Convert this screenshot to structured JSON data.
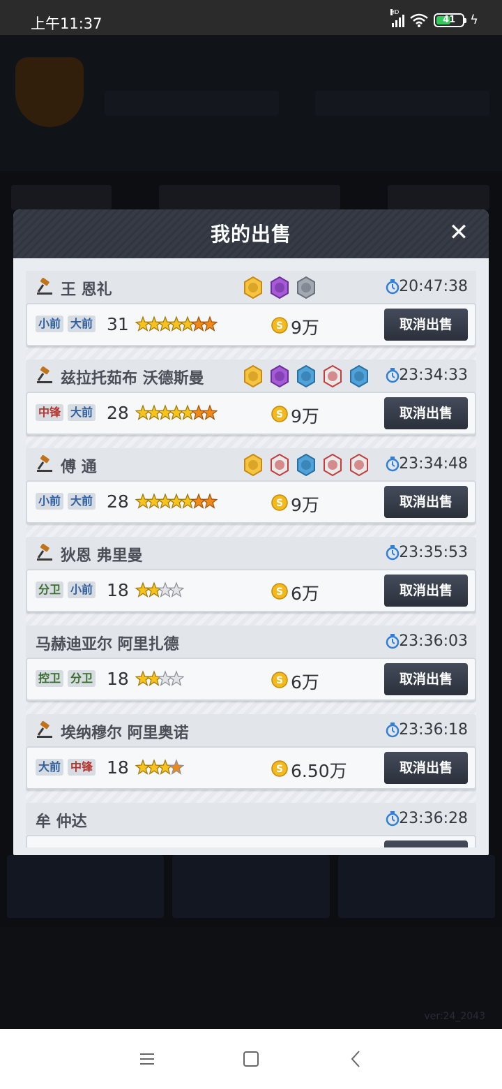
{
  "status_bar": {
    "time": "上午11:37",
    "battery": "41",
    "network": "HD"
  },
  "modal": {
    "title": "我的出售",
    "close": "✕"
  },
  "version": "ver:24_2043",
  "cancel_label": "取消出售",
  "colors": {
    "star_gold": "#f6c21c",
    "star_orange": "#ef8a18",
    "button": "#343a47"
  },
  "items": [
    {
      "name": "王 恩礼",
      "auction": true,
      "skills": [
        "gold",
        "purple",
        "gray"
      ],
      "time": "20:47:38",
      "tags": [
        {
          "t": "小前",
          "c": "blue"
        },
        {
          "t": "大前",
          "c": "blue"
        }
      ],
      "rating": "31",
      "stars": {
        "total": 7,
        "gold": 5,
        "orange": 2,
        "full": 0
      },
      "price": "9万"
    },
    {
      "name": "兹拉托茹布 沃德斯曼",
      "auction": true,
      "skills": [
        "gold",
        "purple",
        "blue",
        "red",
        "blue"
      ],
      "time": "23:34:33",
      "tags": [
        {
          "t": "中锋",
          "c": "red"
        },
        {
          "t": "大前",
          "c": "blue"
        }
      ],
      "rating": "28",
      "stars": {
        "total": 7,
        "gold": 5,
        "orange": 2,
        "full": 0
      },
      "price": "9万"
    },
    {
      "name": "傅 通",
      "auction": true,
      "skills": [
        "gold",
        "red",
        "blue",
        "red",
        "red"
      ],
      "time": "23:34:48",
      "tags": [
        {
          "t": "小前",
          "c": "blue"
        },
        {
          "t": "大前",
          "c": "blue"
        }
      ],
      "rating": "28",
      "stars": {
        "total": 7,
        "gold": 5,
        "orange": 2,
        "full": 1
      },
      "price": "9万"
    },
    {
      "name": "狄恩 弗里曼",
      "auction": true,
      "skills": [],
      "time": "23:35:53",
      "tags": [
        {
          "t": "分卫",
          "c": "green"
        },
        {
          "t": "小前",
          "c": "blue"
        }
      ],
      "rating": "18",
      "stars": {
        "total": 4,
        "gold": 2,
        "orange": 0,
        "full": 0
      },
      "price": "6万"
    },
    {
      "name": "马赫迪亚尔 阿里扎德",
      "auction": false,
      "skills": [],
      "time": "23:36:03",
      "tags": [
        {
          "t": "控卫",
          "c": "green"
        },
        {
          "t": "分卫",
          "c": "green"
        }
      ],
      "rating": "18",
      "stars": {
        "total": 4,
        "gold": 2,
        "orange": 0,
        "full": 0
      },
      "price": "6万"
    },
    {
      "name": "埃纳穆尔 阿里奥诺",
      "auction": true,
      "skills": [],
      "time": "23:36:18",
      "tags": [
        {
          "t": "大前",
          "c": "blue"
        },
        {
          "t": "中锋",
          "c": "red"
        }
      ],
      "rating": "18",
      "stars": {
        "total": 4,
        "gold": 3,
        "orange": 0,
        "full": 1
      },
      "price": "6.50万"
    },
    {
      "name": "牟 仲达",
      "auction": false,
      "skills": [],
      "time": "23:36:28",
      "tags": [],
      "rating": "",
      "stars": {
        "total": 0,
        "gold": 0,
        "orange": 0,
        "full": 0
      },
      "price": ""
    }
  ]
}
